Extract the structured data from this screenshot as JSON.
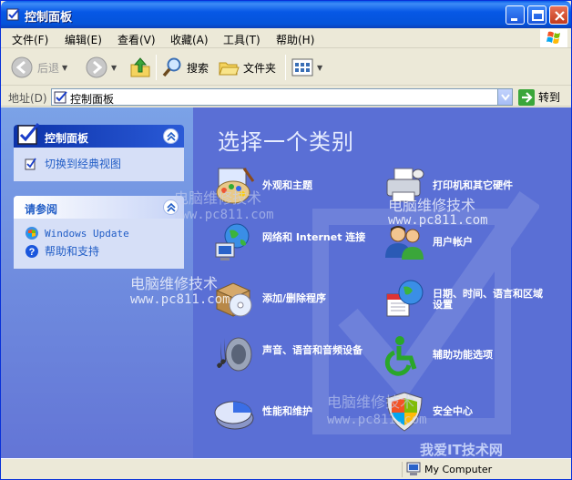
{
  "window": {
    "title": "控制面板"
  },
  "menu": {
    "items": [
      "文件(F)",
      "编辑(E)",
      "查看(V)",
      "收藏(A)",
      "工具(T)",
      "帮助(H)"
    ]
  },
  "toolbar": {
    "back_label": "后退",
    "search_label": "搜索",
    "folders_label": "文件夹"
  },
  "address": {
    "label": "地址(D)",
    "value": "控制面板",
    "go_label": "转到"
  },
  "taskpane": {
    "control_panel_title": "控制面板",
    "switch_view_label": "切换到经典视图",
    "see_also_title": "请参阅",
    "windows_update_label": "Windows Update",
    "help_label": "帮助和支持"
  },
  "main": {
    "heading": "选择一个类别",
    "categories": [
      {
        "label": "外观和主题"
      },
      {
        "label": "打印机和其它硬件"
      },
      {
        "label": "网络和 Internet 连接"
      },
      {
        "label": "用户帐户"
      },
      {
        "label": "添加/删除程序"
      },
      {
        "label": "日期、时间、语言和区域设置"
      },
      {
        "label": "声音、语音和音频设备"
      },
      {
        "label": "辅助功能选项"
      },
      {
        "label": "性能和维护"
      },
      {
        "label": "安全中心"
      }
    ]
  },
  "watermarks": {
    "cn": "电脑维修技术",
    "url": "www.pc811.com",
    "corner": "我爱IT技术网"
  },
  "status": {
    "zone": "My Computer"
  },
  "colors": {
    "title_blue": "#0453d9",
    "pane_blue": "#6375d6",
    "link_blue": "#215dc6"
  }
}
